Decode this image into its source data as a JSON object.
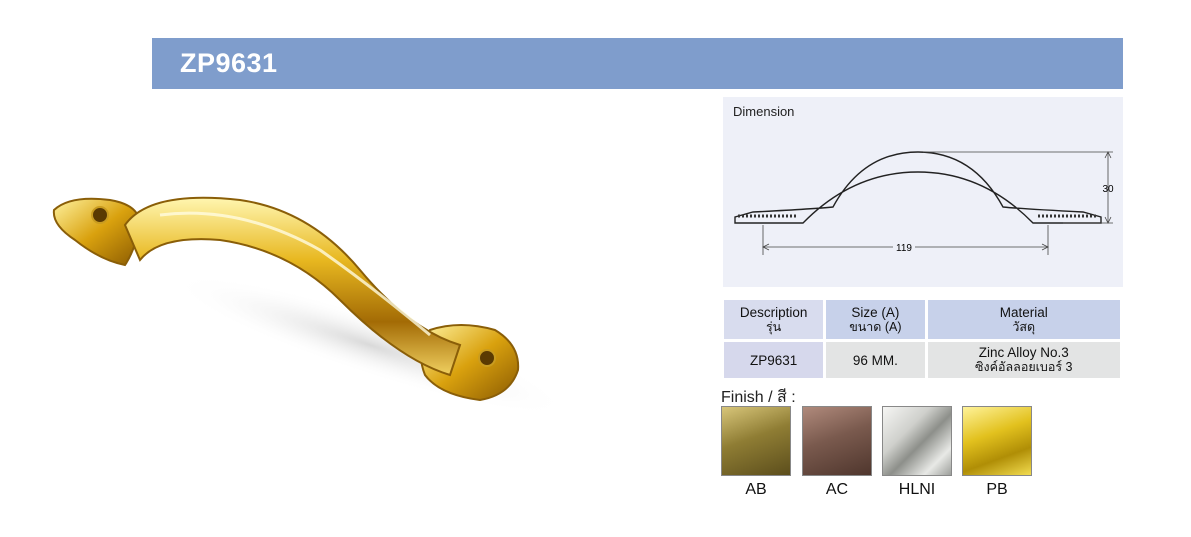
{
  "header": {
    "title": "ZP9631"
  },
  "dimension": {
    "label": "Dimension",
    "width_value": "119",
    "height_value": "30"
  },
  "spec_table": {
    "headers": [
      {
        "line1": "Description",
        "line2": "รุ่น"
      },
      {
        "line1": "Size (A)",
        "line2": "ขนาด (A)"
      },
      {
        "line1": "Material",
        "line2": "วัสดุ"
      }
    ],
    "row": {
      "model": "ZP9631",
      "size": "96 MM.",
      "material_line1": "Zinc Alloy No.3",
      "material_line2": "ซิงค์อัลลอยเบอร์ 3"
    }
  },
  "finish": {
    "title": "Finish / สี :",
    "options": [
      {
        "code": "AB",
        "color": "#8f7d34"
      },
      {
        "code": "AC",
        "color": "#7a5a4e"
      },
      {
        "code": "HLNI",
        "color": "#cfd0cc"
      },
      {
        "code": "PB",
        "color": "#e2c11e"
      }
    ]
  }
}
